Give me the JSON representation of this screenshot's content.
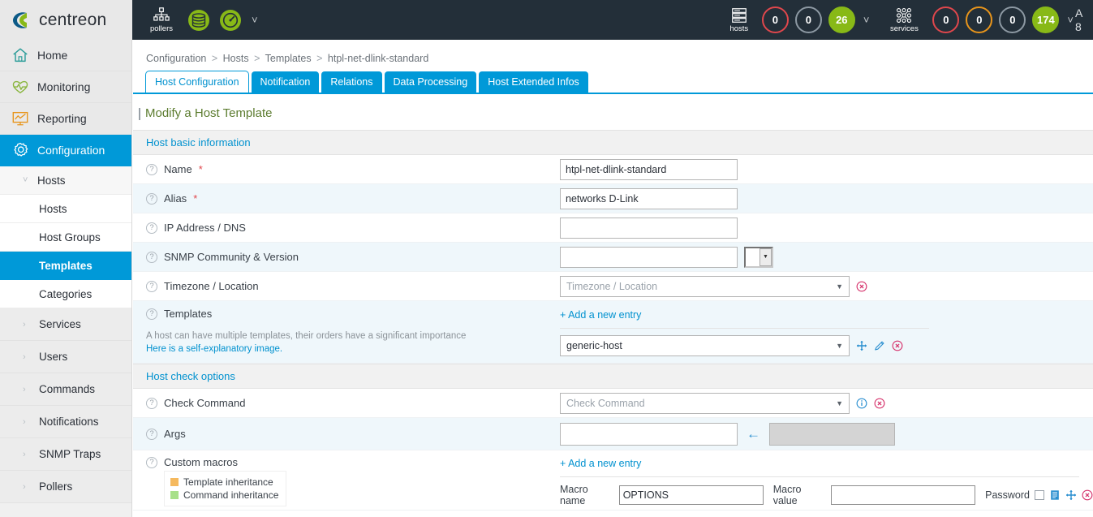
{
  "header": {
    "brand_name": "centreon",
    "pollers_label": "pollers",
    "services_label": "services",
    "hosts_label": "hosts",
    "hosts_badges": [
      {
        "value": "0",
        "style": "red"
      },
      {
        "value": "0",
        "style": "grey"
      },
      {
        "value": "26",
        "style": "green"
      }
    ],
    "services_badges": [
      {
        "value": "0",
        "style": "red"
      },
      {
        "value": "0",
        "style": "orange"
      },
      {
        "value": "0",
        "style": "grey"
      },
      {
        "value": "174",
        "style": "green"
      }
    ],
    "cut_text_line1": "A",
    "cut_text_line2": "8"
  },
  "sidebar": {
    "items": [
      {
        "label": "Home",
        "icon": "home-icon"
      },
      {
        "label": "Monitoring",
        "icon": "heartbeat-icon"
      },
      {
        "label": "Reporting",
        "icon": "chart-board-icon"
      },
      {
        "label": "Configuration",
        "icon": "gear-icon",
        "active": true
      }
    ],
    "hosts_group": "Hosts",
    "hosts_children": [
      {
        "label": "Hosts"
      },
      {
        "label": "Host Groups"
      },
      {
        "label": "Templates",
        "active": true
      },
      {
        "label": "Categories"
      }
    ],
    "groups": [
      {
        "label": "Services"
      },
      {
        "label": "Users"
      },
      {
        "label": "Commands"
      },
      {
        "label": "Notifications"
      },
      {
        "label": "SNMP Traps"
      },
      {
        "label": "Pollers"
      }
    ]
  },
  "breadcrumb": {
    "item1": "Configuration",
    "item2": "Hosts",
    "item3": "Templates",
    "item4": "htpl-net-dlink-standard"
  },
  "tabs": [
    {
      "label": "Host Configuration",
      "active": true
    },
    {
      "label": "Notification",
      "active": false
    },
    {
      "label": "Relations",
      "active": false
    },
    {
      "label": "Data Processing",
      "active": false
    },
    {
      "label": "Host Extended Infos",
      "active": false
    }
  ],
  "page_title": "Modify a Host Template",
  "sections": {
    "basic": "Host basic information",
    "check": "Host check options"
  },
  "fields": {
    "name_label": "Name",
    "name_value": "htpl-net-dlink-standard",
    "alias_label": "Alias",
    "alias_value": "networks D-Link",
    "ip_label": "IP Address / DNS",
    "ip_value": "",
    "snmp_label": "SNMP Community & Version",
    "snmp_value": "",
    "timezone_label": "Timezone / Location",
    "timezone_placeholder": "Timezone / Location",
    "templates_label": "Templates",
    "templates_help": "A host can have multiple templates, their orders have a significant importance",
    "templates_help_link": "Here is a self-explanatory image.",
    "add_entry": "+ Add a new entry",
    "template_value": "generic-host",
    "check_command_label": "Check Command",
    "check_command_placeholder": "Check Command",
    "args_label": "Args",
    "args_value": "",
    "custom_macros_label": "Custom macros",
    "macros_add_entry": "+ Add a new entry",
    "legend_template": "Template inheritance",
    "legend_command": "Command inheritance",
    "macro_name_label": "Macro name",
    "macro_name_value": "OPTIONS",
    "macro_value_label": "Macro value",
    "macro_value_value": "",
    "password_label": "Password"
  },
  "colors": {
    "accent_blue": "#0099d8",
    "green": "#88b917",
    "red": "#e0474c",
    "orange": "#e8951b",
    "dark": "#232f39",
    "title_green": "#5b7b2e",
    "swatch_template": "#f5b95e",
    "swatch_command": "#a8e08a"
  }
}
